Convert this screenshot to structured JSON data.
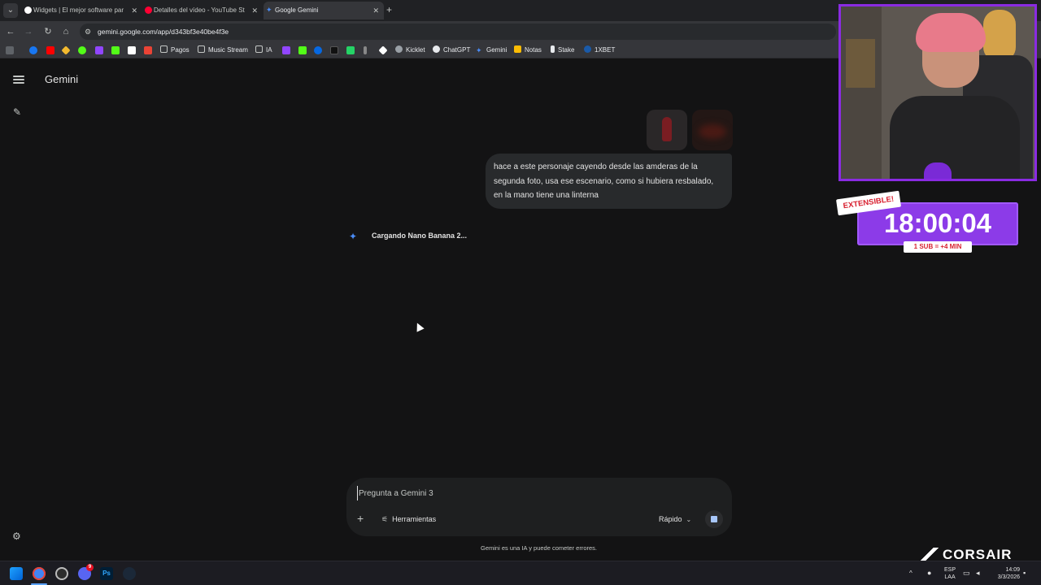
{
  "browser": {
    "tabs": [
      {
        "title": "Widgets | El mejor software par",
        "favicon_color": "#ffffff"
      },
      {
        "title": "Detalles del vídeo - YouTube St",
        "favicon_color": "#ff0033"
      },
      {
        "title": "Google Gemini",
        "favicon_color": "#4a8cf7"
      }
    ],
    "url": "gemini.google.com/app/d343bf3e40be4f3e",
    "bookmarks": [
      {
        "label": "Pagos"
      },
      {
        "label": "Music Stream"
      },
      {
        "label": "IA"
      },
      {
        "label": "Kicklet"
      },
      {
        "label": "ChatGPT"
      },
      {
        "label": "Gemini"
      },
      {
        "label": "Notas"
      },
      {
        "label": "Stake"
      },
      {
        "label": "1XBET"
      }
    ]
  },
  "app": {
    "brand": "Gemini",
    "user_message": "hace a este personaje cayendo desde las amderas de la segunda foto, usa ese escenario, como si hubiera resbalado, en la mano tiene una linterna",
    "loading_text": "Cargando Nano Banana 2...",
    "composer": {
      "placeholder": "Pregunta a Gemini 3",
      "tools_label": "Herramientas",
      "model_label": "Rápido"
    },
    "disclaimer": "Gemini es una IA y puede cometer errores."
  },
  "overlay": {
    "ribbon": "EXTENSIBLE!",
    "timer": "18:00:04",
    "sub_rule": "1 SUB = +4 MIN",
    "sponsor": "CORSAIR"
  },
  "taskbar": {
    "lang_top": "ESP",
    "lang_bottom": "LAA",
    "time": "14:09",
    "date": "3/3/2026",
    "notification_count": "9"
  },
  "colors": {
    "accent": "#4a8cf7",
    "overlay_purple": "#8c3be8",
    "background": "#131314"
  }
}
